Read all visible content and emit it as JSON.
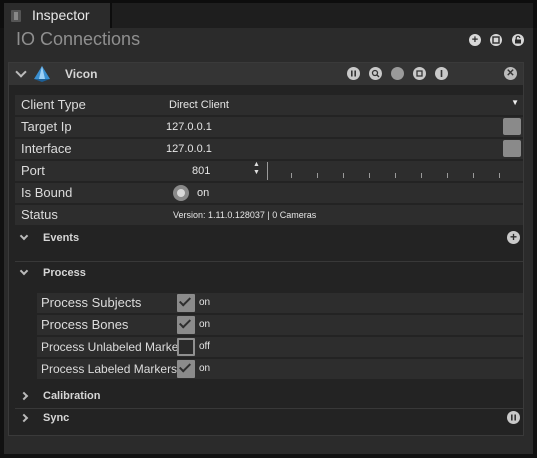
{
  "tab": {
    "label": "Inspector"
  },
  "panel": {
    "title": "IO Connections"
  },
  "component": {
    "name": "Vicon",
    "fields": {
      "client_type": {
        "label": "Client Type",
        "value": "Direct Client"
      },
      "target_ip": {
        "label": "Target Ip",
        "value": "127.0.0.1"
      },
      "interface": {
        "label": "Interface",
        "value": "127.0.0.1"
      },
      "port": {
        "label": "Port",
        "value": "801"
      },
      "is_bound": {
        "label": "Is Bound",
        "value": "on"
      },
      "status": {
        "label": "Status",
        "value": "Version: 1.11.0.128037 | 0 Cameras"
      }
    },
    "sections": {
      "events": {
        "label": "Events"
      },
      "process": {
        "label": "Process",
        "items": [
          {
            "label": "Process Subjects",
            "checked": true,
            "state": "on"
          },
          {
            "label": "Process Bones",
            "checked": true,
            "state": "on"
          },
          {
            "label": "Process Unlabeled Marker",
            "checked": false,
            "state": "off"
          },
          {
            "label": "Process Labeled Markers",
            "checked": true,
            "state": "on"
          }
        ]
      },
      "calibration": {
        "label": "Calibration"
      },
      "sync": {
        "label": "Sync"
      }
    }
  }
}
